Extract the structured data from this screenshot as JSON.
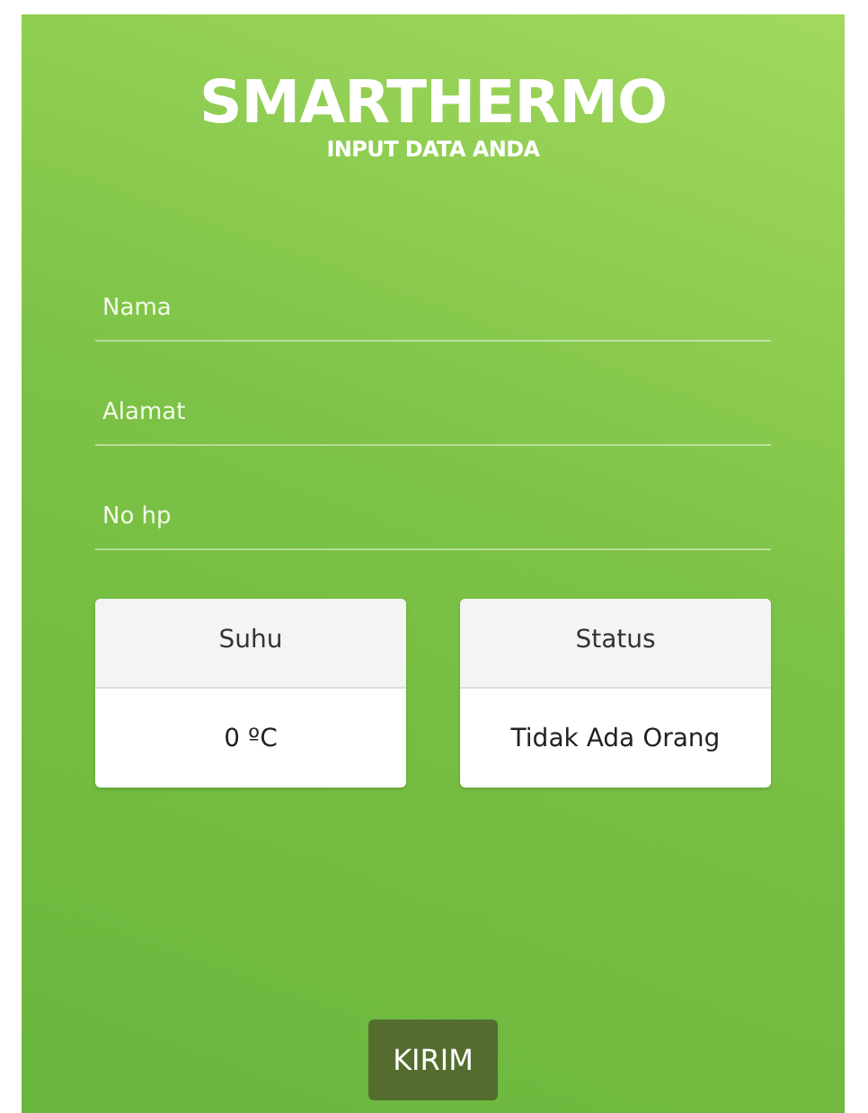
{
  "header": {
    "title": "SMARTHERMO",
    "subtitle": "INPUT DATA ANDA"
  },
  "fields": [
    {
      "placeholder": "Nama"
    },
    {
      "placeholder": "Alamat"
    },
    {
      "placeholder": "No hp"
    }
  ],
  "cards": [
    {
      "label": "Suhu",
      "value": "0 ºC"
    },
    {
      "label": "Status",
      "value": "Tidak Ada Orang"
    }
  ],
  "buttons": [
    "KIRIM"
  ]
}
